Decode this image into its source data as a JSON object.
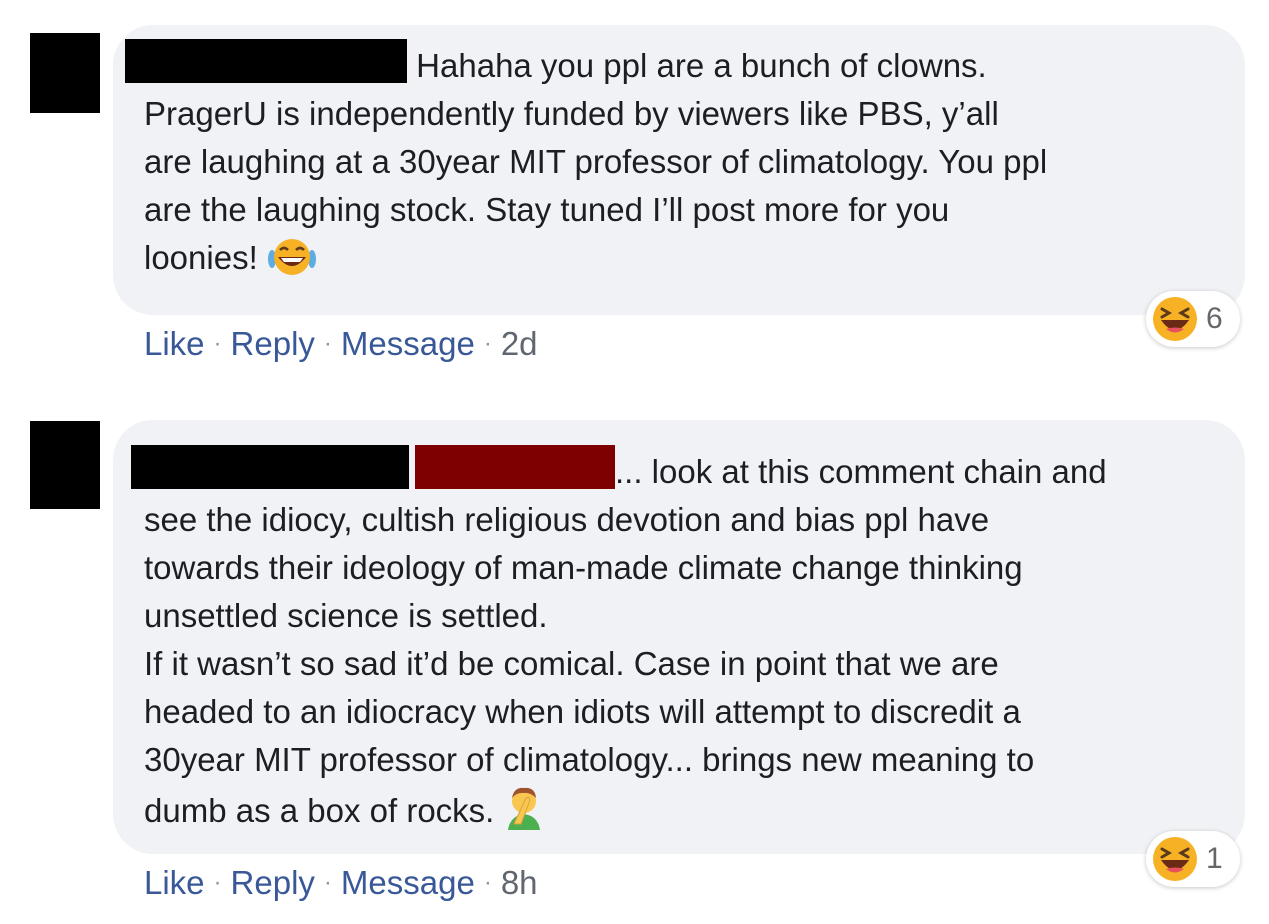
{
  "comments": [
    {
      "text_first": "Hahaha you ppl are a bunch of clowns.",
      "text_lines": [
        "PragerU is independently funded by viewers like PBS, y’all",
        "are laughing at a 30year MIT professor of climatology. You ppl",
        "are the laughing stock. Stay tuned I’ll post more for you",
        "loonies!"
      ],
      "inline_emoji": "face-with-tears-of-joy-icon",
      "reaction_icon": "laughing-face-icon",
      "reaction_count": "6",
      "actions": {
        "like": "Like",
        "reply": "Reply",
        "message": "Message",
        "sep": "·",
        "time": "2d"
      }
    },
    {
      "text_first": "... look at this comment chain and",
      "text_lines": [
        "see the idiocy, cultish religious devotion and bias ppl have",
        "towards their ideology of man-made climate change thinking",
        "unsettled science is settled.",
        "If it wasn’t so sad it’d be comical. Case in point that we are",
        "headed to an idiocracy when idiots will attempt to discredit a",
        "30year MIT professor of climatology... brings new meaning to",
        "dumb as a box of rocks."
      ],
      "inline_emoji": "man-facepalming-icon",
      "reaction_icon": "laughing-face-icon",
      "reaction_count": "1",
      "actions": {
        "like": "Like",
        "reply": "Reply",
        "message": "Message",
        "sep": "·",
        "time": "8h"
      }
    }
  ],
  "colors": {
    "bubble": "#f0f2f5",
    "link": "#385898",
    "redaction_black": "#000000",
    "redaction_red": "#7e0000",
    "emoji_yellow": "#f7b125"
  }
}
